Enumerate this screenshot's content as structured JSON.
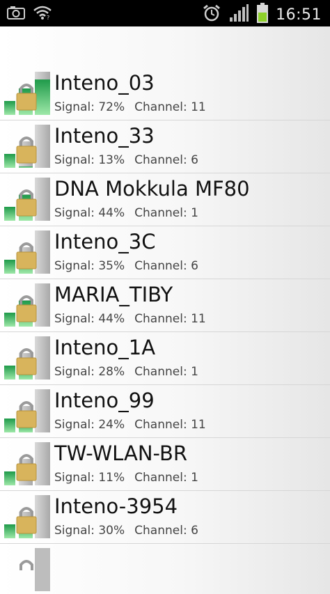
{
  "status_bar": {
    "time": "16:51",
    "icons": [
      "camera-icon",
      "wifi-notification-icon",
      "alarm-icon",
      "cell-signal-icon",
      "battery-icon"
    ]
  },
  "networks": [
    {
      "ssid": "Inteno_03",
      "signal_label": "Signal:",
      "signal": "72%",
      "channel_label": "Channel:",
      "channel": "11",
      "signal_level": 0.72
    },
    {
      "ssid": "Inteno_33",
      "signal_label": "Signal:",
      "signal": "13%",
      "channel_label": "Channel:",
      "channel": "6",
      "signal_level": 0.13
    },
    {
      "ssid": "DNA Mokkula MF80",
      "signal_label": "Signal:",
      "signal": "44%",
      "channel_label": "Channel:",
      "channel": "1",
      "signal_level": 0.44
    },
    {
      "ssid": "Inteno_3C",
      "signal_label": "Signal:",
      "signal": "35%",
      "channel_label": "Channel:",
      "channel": "6",
      "signal_level": 0.35
    },
    {
      "ssid": "MARIA_TIBY",
      "signal_label": "Signal:",
      "signal": "44%",
      "channel_label": "Channel:",
      "channel": "11",
      "signal_level": 0.44
    },
    {
      "ssid": "Inteno_1A",
      "signal_label": "Signal:",
      "signal": "28%",
      "channel_label": "Channel:",
      "channel": "1",
      "signal_level": 0.28
    },
    {
      "ssid": "Inteno_99",
      "signal_label": "Signal:",
      "signal": "24%",
      "channel_label": "Channel:",
      "channel": "11",
      "signal_level": 0.24
    },
    {
      "ssid": "TW-WLAN-BR",
      "signal_label": "Signal:",
      "signal": "11%",
      "channel_label": "Channel:",
      "channel": "1",
      "signal_level": 0.11
    },
    {
      "ssid": "Inteno-3954",
      "signal_label": "Signal:",
      "signal": "30%",
      "channel_label": "Channel:",
      "channel": "6",
      "signal_level": 0.3
    }
  ],
  "colors": {
    "bar_green": "#1f9a4a",
    "bar_light_green": "#9ee8a8",
    "bar_grey": "#bdbdbd",
    "lock_gold": "#d8b45c",
    "lock_shackle": "#9a9a9a"
  }
}
